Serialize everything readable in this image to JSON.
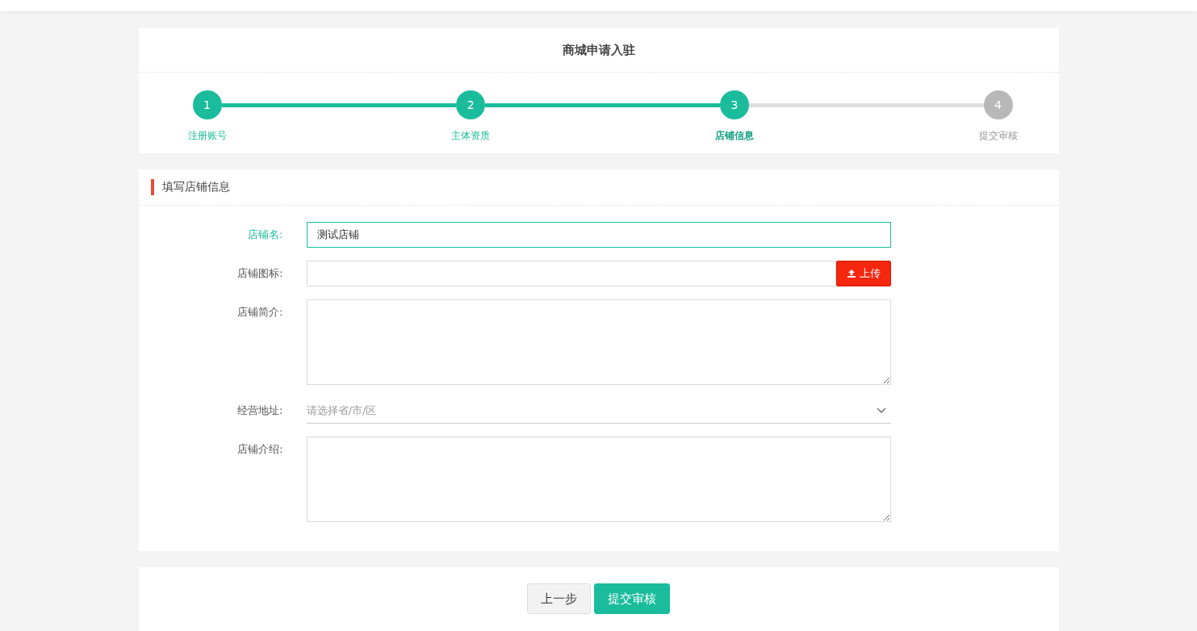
{
  "page_title": "商城申请入驻",
  "steps": [
    {
      "number": "1",
      "label": "注册账号",
      "done": true,
      "selected": false
    },
    {
      "number": "2",
      "label": "主体资质",
      "done": true,
      "selected": false
    },
    {
      "number": "3",
      "label": "店铺信息",
      "done": true,
      "selected": true
    },
    {
      "number": "4",
      "label": "提交审核",
      "done": false,
      "selected": false
    }
  ],
  "section_title": "填写店铺信息",
  "fields": [
    {
      "kind": "text",
      "label": "店铺名:",
      "value": "测试店铺",
      "focused": true
    },
    {
      "kind": "upload",
      "label": "店铺图标:",
      "button": "上传",
      "focused": false
    },
    {
      "kind": "textarea",
      "label": "店铺简介:",
      "focused": false
    },
    {
      "kind": "select",
      "label": "经营地址:",
      "placeholder": "请选择省/市/区",
      "focused": false
    },
    {
      "kind": "textarea",
      "label": "店铺介绍:",
      "focused": false
    }
  ],
  "buttons": [
    {
      "kind": "secondary",
      "label": "上一步"
    },
    {
      "kind": "primary",
      "label": "提交审核"
    }
  ]
}
